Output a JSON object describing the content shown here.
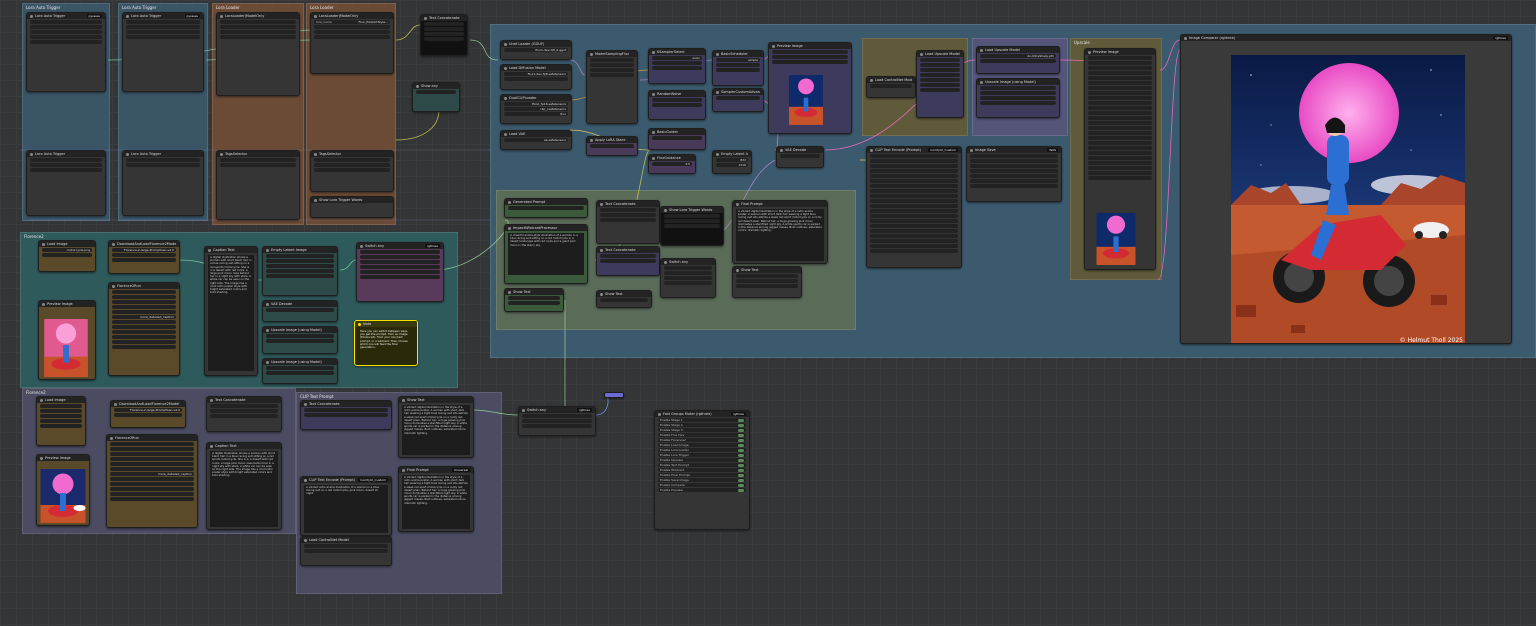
{
  "groups": {
    "g1": "Lora Auto Trigger",
    "g2": "Lora Auto Trigger",
    "g3": "Lora Loader",
    "g4": "Lora Loader",
    "main": "",
    "prompt_gen": "Florence2",
    "prompt_gen2": "Florence2",
    "clip": "CLIP Text Prompt",
    "upscale": "Upscale"
  },
  "nodes": {
    "lora_trigger_a": {
      "title": "Lora Auto Trigger",
      "badge": "pysssss"
    },
    "lora_trigger_b": {
      "title": "Lora Auto Trigger",
      "badge": "pysssss"
    },
    "lora_loader": {
      "title": "LoraLoader|ModelOnly",
      "badge": "Lora Auto Trigger",
      "field1_label": "lora_name",
      "field1_value": "Flux_PixelArtStyle..."
    },
    "tag_select": {
      "title": "TagsSelector"
    },
    "lora_words": {
      "title": "Show Lora Trigger Words"
    },
    "text_concat": {
      "title": "Text Concatenate",
      "badge": "WAS"
    },
    "show_any": {
      "title": "Show any",
      "badge": "Universal"
    },
    "unet_loader": {
      "title": "Unet Loader (GGUF)",
      "value": "flux1-dev-Q8_0.gguf"
    },
    "load_diff": {
      "title": "Load Diffusion Model",
      "value": "flux1-dev-fp8.safetensors"
    },
    "dual_clip": {
      "title": "DualCLIPLoader",
      "value1": "t5xxl_fp16.safetensors",
      "value2": "clip_l.safetensors",
      "type": "flux"
    },
    "load_vae": {
      "title": "Load VAE",
      "value": "ae.safetensors"
    },
    "model_sampling": {
      "title": "ModelSamplingFlux"
    },
    "apply_lora": {
      "title": "Apply LoRA Stack"
    },
    "sampler_sel": {
      "title": "KSamplerSelect",
      "value": "euler"
    },
    "sampler_custom": {
      "title": "SamplerCustomAdvanced"
    },
    "basic_sched": {
      "title": "BasicScheduler",
      "value": "simple"
    },
    "random_noise": {
      "title": "RandomNoise"
    },
    "guider": {
      "title": "BasicGuider"
    },
    "vae_decode": {
      "title": "VAE Decode"
    },
    "empty_latent": {
      "title": "Empty Latent Image",
      "width": "832",
      "height": "1216"
    },
    "flux_guidance": {
      "title": "FluxGuidance",
      "value": "3.5"
    },
    "gen_prompt": {
      "title": "Generated Prompt"
    },
    "wildcard": {
      "title": "ImpactWildcardProcessor"
    },
    "wildcard_txt": "A cheerful anime-style illustration of a woman in a blue racing suit sitting on a red motorcycle in a desert landscape with red rocks and a giant pink moon in the starry sky.",
    "final_prompt": {
      "title": "Final Prompt",
      "badge": "Universal"
    },
    "final_txt": "A vibrant digital illustration in the style of a retro anime poster. A woman with short dark hair wearing a tight blue racing suit sits astride a sleek red sport motorcycle on a rocky red desert plain. Behind her, a huge glowing pink moon dominates a star-filled night sky. A white sports car is parked in the distance among jagged mesas. Bold outlines, saturated colors, dramatic lighting.",
    "show_text": {
      "title": "Show Text"
    },
    "florence_load": {
      "title": "DownloadAndLoadFlorence2Model",
      "value": "Florence-2-large-PromptGen-v2.0"
    },
    "florence_run": {
      "title": "Florence2Run",
      "task": "more_detailed_caption"
    },
    "load_img": {
      "title": "Load Image",
      "filename": "motorcycle.png"
    },
    "caption": {
      "title": "Caption Text",
      "badge": "Universal"
    },
    "caption_txt": "A digital illustration shows a woman with short black hair in a blue racing suit sitting on a red sports motorcycle. She is in a desert with red rocks. A large pink moon rises behind her in a night sky with stars. A white car can be seen on the right side. The image has a vivid retro poster style with bright saturated colors and bold shading.",
    "note": {
      "title": "Note",
      "text": "Here you can switch between ways you get the prompt: from an image (Florence2), from your own text prompt, or a wildcard. Then choose which one will feed the final generation."
    },
    "switch": {
      "title": "Switch any",
      "badge": "rgthree"
    },
    "fast_groups": {
      "title": "Fast Groups Muter (rgthree)",
      "badge": "rgthree",
      "items": [
        "Enable Stage 1",
        "Enable Stage 2",
        "Enable Stage 3",
        "Enable Flux Dev",
        "Enable Florence2",
        "Enable Load Image",
        "Enable Lora Loader",
        "Enable Lora Trigger",
        "Enable Upscale",
        "Enable Text Prompt",
        "Enable Wildcard",
        "Enable Final Prompt",
        "Enable Save Image",
        "Enable Compare",
        "Enable Preview"
      ]
    },
    "clip_text": {
      "title": "CLIP Text Encode (Prompt)",
      "badge": "ComfyUI_Custom"
    },
    "clip_txt": "A vibrant retro anime illustration of a woman in a blue racing suit on a red motorcycle, pink moon, desert at night.",
    "controlnet": {
      "title": "Load ControlNet Model",
      "badge": "ComfyUI"
    },
    "upscaler_load": {
      "title": "Load Upscale Model",
      "value": "4x-UltraSharp.pth"
    },
    "upscale_node": {
      "title": "Upscale Image (using Model)"
    },
    "image_save": {
      "title": "Image Save",
      "badge": "WAS"
    },
    "image_compare": {
      "title": "Image Comparer (rgthree)",
      "badge": "rgthree"
    },
    "preview_a": {
      "title": "Preview Image"
    },
    "preview_b": {
      "title": "Preview Image"
    },
    "watermark": "© Helmut Tholl 2025"
  },
  "colors": {
    "canvas": "#343536",
    "group_blue": "#3c5a6f",
    "group_brown": "#6b4b35",
    "group_teal": "#2e5a5c",
    "group_green": "#5b6b55",
    "group_purple": "#4a4a6a",
    "group_olive": "#5c5a3a",
    "moon": "#f06ad0",
    "bike": "#d42a33",
    "suit": "#2a6fd1",
    "sky": "#0d2050"
  }
}
